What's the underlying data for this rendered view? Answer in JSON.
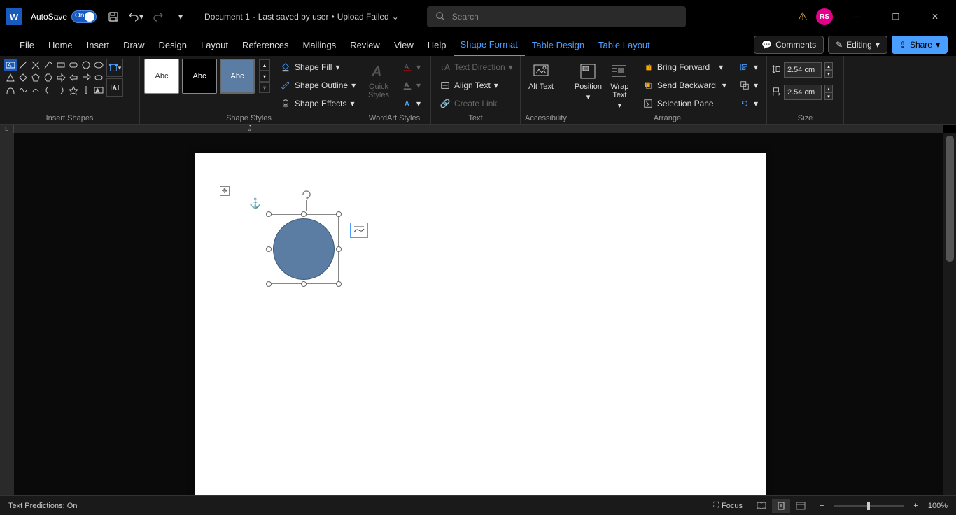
{
  "title": {
    "autosave_label": "AutoSave",
    "autosave_state": "On",
    "doc_name": "Document 1",
    "doc_sep": "-",
    "saved_by": "Last saved by user",
    "bullet": "•",
    "upload_status": "Upload Failed",
    "search_placeholder": "Search",
    "user_initials": "RS"
  },
  "tabs": {
    "file": "File",
    "home": "Home",
    "insert": "Insert",
    "draw": "Draw",
    "design": "Design",
    "layout": "Layout",
    "references": "References",
    "mailings": "Mailings",
    "review": "Review",
    "view": "View",
    "help": "Help",
    "shape_format": "Shape Format",
    "table_design": "Table Design",
    "table_layout": "Table Layout",
    "comments": "Comments",
    "editing": "Editing",
    "share": "Share"
  },
  "ribbon": {
    "insert_shapes": "Insert Shapes",
    "shape_styles": "Shape Styles",
    "wordart_styles": "WordArt Styles",
    "text": "Text",
    "accessibility": "Accessibility",
    "arrange": "Arrange",
    "size": "Size",
    "abc": "Abc",
    "shape_fill": "Shape Fill",
    "shape_outline": "Shape Outline",
    "shape_effects": "Shape Effects",
    "quick_styles": "Quick Styles",
    "text_direction": "Text Direction",
    "align_text": "Align Text",
    "create_link": "Create Link",
    "alt_text": "Alt Text",
    "position": "Position",
    "wrap_text": "Wrap Text",
    "bring_forward": "Bring Forward",
    "send_backward": "Send Backward",
    "selection_pane": "Selection Pane",
    "height_val": "2.54 cm",
    "width_val": "2.54 cm"
  },
  "status": {
    "predictions": "Text Predictions: On",
    "focus": "Focus",
    "zoom": "100%"
  }
}
